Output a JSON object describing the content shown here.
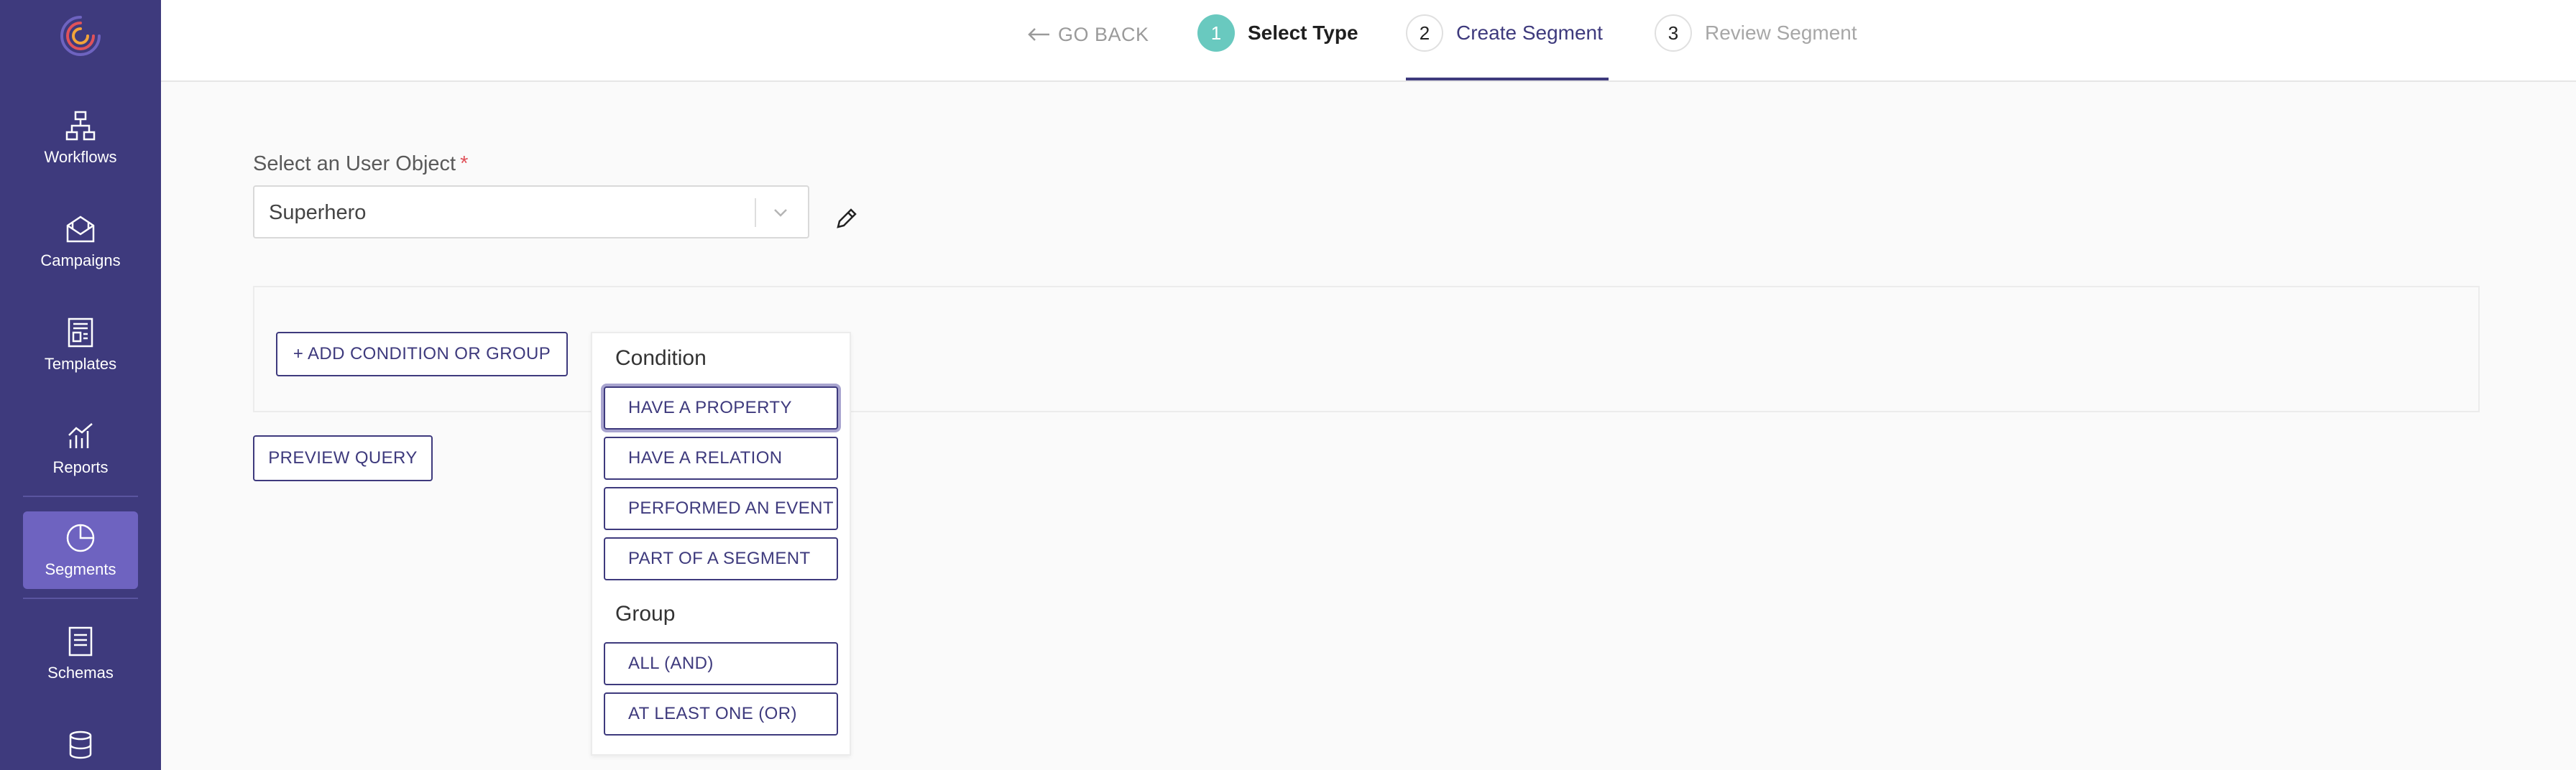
{
  "sidebar": {
    "items": [
      {
        "label": "Workflows"
      },
      {
        "label": "Campaigns"
      },
      {
        "label": "Templates"
      },
      {
        "label": "Reports"
      },
      {
        "label": "Segments",
        "active": true
      },
      {
        "label": "Schemas"
      }
    ],
    "accent_color": "#3e3a7d",
    "active_color": "#6e63c0"
  },
  "stepper": {
    "go_back": "GO BACK",
    "steps": [
      {
        "number": "1",
        "label": "Select Type",
        "state": "completed"
      },
      {
        "number": "2",
        "label": "Create Segment",
        "state": "active"
      },
      {
        "number": "3",
        "label": "Review Segment",
        "state": "upcoming"
      }
    ],
    "completed_color": "#69c9bf"
  },
  "form": {
    "user_object_label": "Select an User Object",
    "required_mark": "*",
    "user_object_value": "Superhero"
  },
  "query": {
    "add_button": "+ ADD CONDITION OR GROUP",
    "preview_button": "PREVIEW QUERY"
  },
  "menu": {
    "condition_heading": "Condition",
    "condition_options": [
      "HAVE A PROPERTY",
      "HAVE A RELATION",
      "PERFORMED AN EVENT",
      "PART OF A SEGMENT"
    ],
    "group_heading": "Group",
    "group_options": [
      "ALL (AND)",
      "AT LEAST ONE (OR)"
    ]
  }
}
